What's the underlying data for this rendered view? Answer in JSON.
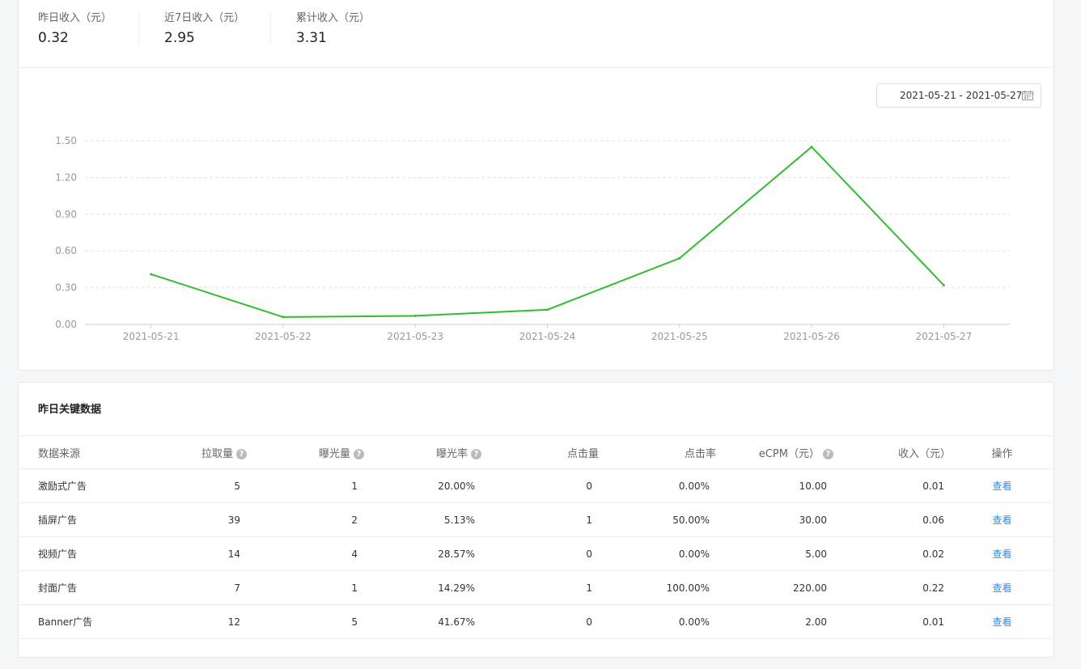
{
  "stats": [
    {
      "label": "昨日收入（元）",
      "value": "0.32"
    },
    {
      "label": "近7日收入（元）",
      "value": "2.95"
    },
    {
      "label": "累计收入（元）",
      "value": "3.31"
    }
  ],
  "date_range": "2021-05-21 - 2021-05-27",
  "date_icon": "calendar-icon",
  "chart_data": {
    "type": "line",
    "x": [
      "2021-05-21",
      "2021-05-22",
      "2021-05-23",
      "2021-05-24",
      "2021-05-25",
      "2021-05-26",
      "2021-05-27"
    ],
    "y_ticks": [
      "0.00",
      "0.30",
      "0.60",
      "0.90",
      "1.20",
      "1.50"
    ],
    "ylim": [
      0,
      1.5
    ],
    "series": [
      {
        "values": [
          0.41,
          0.06,
          0.07,
          0.12,
          0.54,
          1.45,
          0.32
        ],
        "color": "#2fbe2f"
      }
    ],
    "grid": "dashed horizontal"
  },
  "table": {
    "title": "昨日关键数据",
    "headers": [
      "数据来源",
      "拉取量",
      "曝光量",
      "曝光率",
      "点击量",
      "点击率",
      "eCPM（元）",
      "收入（元）",
      "操作"
    ],
    "rows": [
      {
        "source": "激励式广告",
        "pull": "5",
        "expose": "1",
        "expose_rate": "20.00%",
        "clicks": "0",
        "ctr": "0.00%",
        "ecpm": "10.00",
        "revenue": "0.01",
        "action": "查看"
      },
      {
        "source": "插屏广告",
        "pull": "39",
        "expose": "2",
        "expose_rate": "5.13%",
        "clicks": "1",
        "ctr": "50.00%",
        "ecpm": "30.00",
        "revenue": "0.06",
        "action": "查看"
      },
      {
        "source": "视频广告",
        "pull": "14",
        "expose": "4",
        "expose_rate": "28.57%",
        "clicks": "0",
        "ctr": "0.00%",
        "ecpm": "5.00",
        "revenue": "0.02",
        "action": "查看"
      },
      {
        "source": "封面广告",
        "pull": "7",
        "expose": "1",
        "expose_rate": "14.29%",
        "clicks": "1",
        "ctr": "100.00%",
        "ecpm": "220.00",
        "revenue": "0.22",
        "action": "查看"
      },
      {
        "source": "Banner广告",
        "pull": "12",
        "expose": "5",
        "expose_rate": "41.67%",
        "clicks": "0",
        "ctr": "0.00%",
        "ecpm": "2.00",
        "revenue": "0.01",
        "action": "查看"
      }
    ]
  },
  "colors": {
    "accent": "#2d8cf0",
    "line": "#2fbe2f"
  }
}
